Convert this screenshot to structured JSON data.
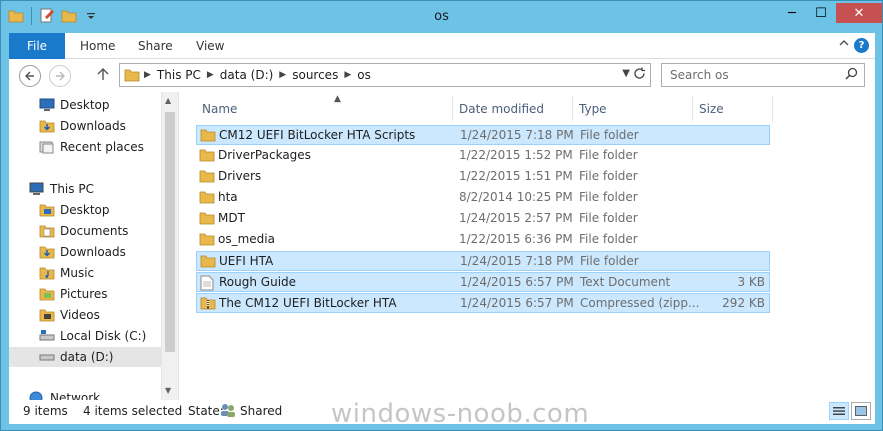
{
  "window": {
    "title": "os",
    "minimize_glyph": "─",
    "maximize_glyph": "☐",
    "close_glyph": "✕"
  },
  "ribbon": {
    "tabs": [
      {
        "label": "File"
      },
      {
        "label": "Home"
      },
      {
        "label": "Share"
      },
      {
        "label": "View"
      }
    ],
    "help_glyph": "?"
  },
  "address": {
    "crumbs": [
      "This PC",
      "data (D:)",
      "sources",
      "os"
    ]
  },
  "search": {
    "placeholder": "Search os"
  },
  "nav": {
    "items": [
      {
        "label": "Desktop",
        "icon": "desktop-icon"
      },
      {
        "label": "Downloads",
        "icon": "downloads-icon"
      },
      {
        "label": "Recent places",
        "icon": "recent-places-icon"
      },
      {
        "label": "This PC",
        "icon": "computer-icon"
      },
      {
        "label": "Desktop",
        "icon": "desktop-folder-icon"
      },
      {
        "label": "Documents",
        "icon": "documents-icon"
      },
      {
        "label": "Downloads",
        "icon": "downloads-icon"
      },
      {
        "label": "Music",
        "icon": "music-icon"
      },
      {
        "label": "Pictures",
        "icon": "pictures-icon"
      },
      {
        "label": "Videos",
        "icon": "videos-icon"
      },
      {
        "label": "Local Disk (C:)",
        "icon": "drive-icon"
      },
      {
        "label": "data (D:)",
        "icon": "drive-icon"
      },
      {
        "label": "Network",
        "icon": "network-icon"
      }
    ]
  },
  "columns": {
    "name": "Name",
    "date": "Date modified",
    "type": "Type",
    "size": "Size"
  },
  "files": [
    {
      "name": "CM12 UEFI BitLocker HTA Scripts",
      "date": "1/24/2015 7:18 PM",
      "type": "File folder",
      "size": "",
      "kind": "folder",
      "selected": true
    },
    {
      "name": "DriverPackages",
      "date": "1/22/2015 1:52 PM",
      "type": "File folder",
      "size": "",
      "kind": "folder",
      "selected": false
    },
    {
      "name": "Drivers",
      "date": "1/22/2015 1:51 PM",
      "type": "File folder",
      "size": "",
      "kind": "folder",
      "selected": false
    },
    {
      "name": "hta",
      "date": "8/2/2014 10:25 PM",
      "type": "File folder",
      "size": "",
      "kind": "folder",
      "selected": false
    },
    {
      "name": "MDT",
      "date": "1/24/2015 2:57 PM",
      "type": "File folder",
      "size": "",
      "kind": "folder",
      "selected": false
    },
    {
      "name": "os_media",
      "date": "1/22/2015 6:36 PM",
      "type": "File folder",
      "size": "",
      "kind": "folder",
      "selected": false
    },
    {
      "name": "UEFI HTA",
      "date": "1/24/2015 7:18 PM",
      "type": "File folder",
      "size": "",
      "kind": "folder",
      "selected": true
    },
    {
      "name": "Rough Guide",
      "date": "1/24/2015 6:57 PM",
      "type": "Text Document",
      "size": "3 KB",
      "kind": "text",
      "selected": true
    },
    {
      "name": "The CM12 UEFI BitLocker HTA",
      "date": "1/24/2015 6:57 PM",
      "type": "Compressed (zipp...",
      "size": "292 KB",
      "kind": "zip",
      "selected": true
    }
  ],
  "status": {
    "items_count": "9 items",
    "selected_count": "4 items selected",
    "state_label": "State:",
    "state_value": "Shared"
  },
  "watermark": "windows-noob.com",
  "colors": {
    "titlebar": "#6cc3e6",
    "file_tab": "#1979ca",
    "selection": "#cce8ff",
    "close": "#c75050",
    "folder": "#e8b84a"
  }
}
